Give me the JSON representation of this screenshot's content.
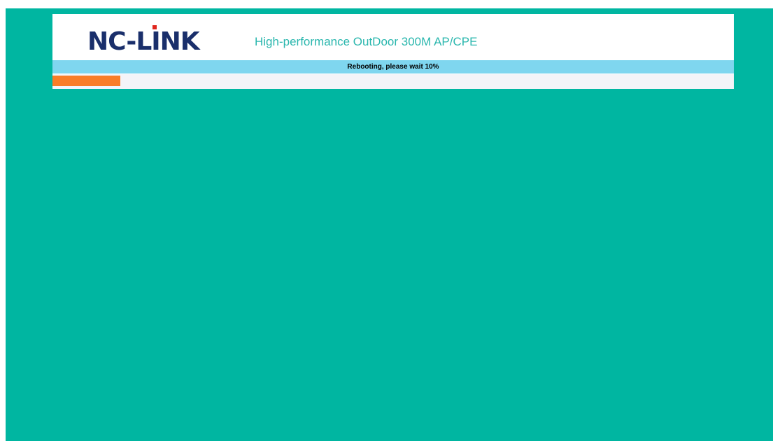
{
  "logo": {
    "parts": [
      "NC-L",
      "I",
      "NK"
    ],
    "text": "NC-LINK",
    "icon": "nc-link-logo"
  },
  "header": {
    "subtitle": "High-performance OutDoor 300M AP/CPE"
  },
  "status": {
    "message": "Rebooting, please wait 10%"
  },
  "progress": {
    "fraction": 0.1
  },
  "colors": {
    "page_background": "#00b6a1",
    "logo_text": "#1a2f6b",
    "logo_dot": "#e0261d",
    "subtitle": "#2bb7ae",
    "status_bar": "#7fd6ef",
    "progress_track": "#f3f4f8",
    "progress_fill": "#fa7d27"
  }
}
